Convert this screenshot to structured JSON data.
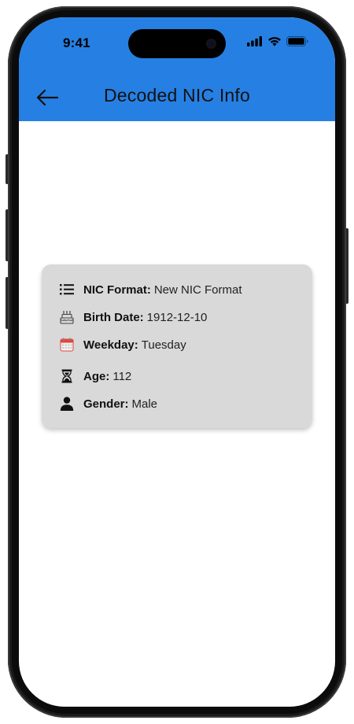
{
  "status_bar": {
    "time": "9:41"
  },
  "app_bar": {
    "title": "Decoded NIC Info",
    "back_icon": "arrow-left-icon",
    "background_color": "#2680e3"
  },
  "info_card": {
    "background_color": "#d9d9d9",
    "rows": [
      {
        "icon": "list-icon",
        "label": "NIC Format:",
        "value": "New NIC Format"
      },
      {
        "icon": "birthday-cake-icon",
        "label": "Birth Date:",
        "value": "1912-12-10"
      },
      {
        "icon": "calendar-icon",
        "label": "Weekday:",
        "value": "Tuesday"
      },
      {
        "icon": "hourglass-icon",
        "label": "Age:",
        "value": "112"
      },
      {
        "icon": "person-icon",
        "label": "Gender:",
        "value": "Male"
      }
    ]
  }
}
